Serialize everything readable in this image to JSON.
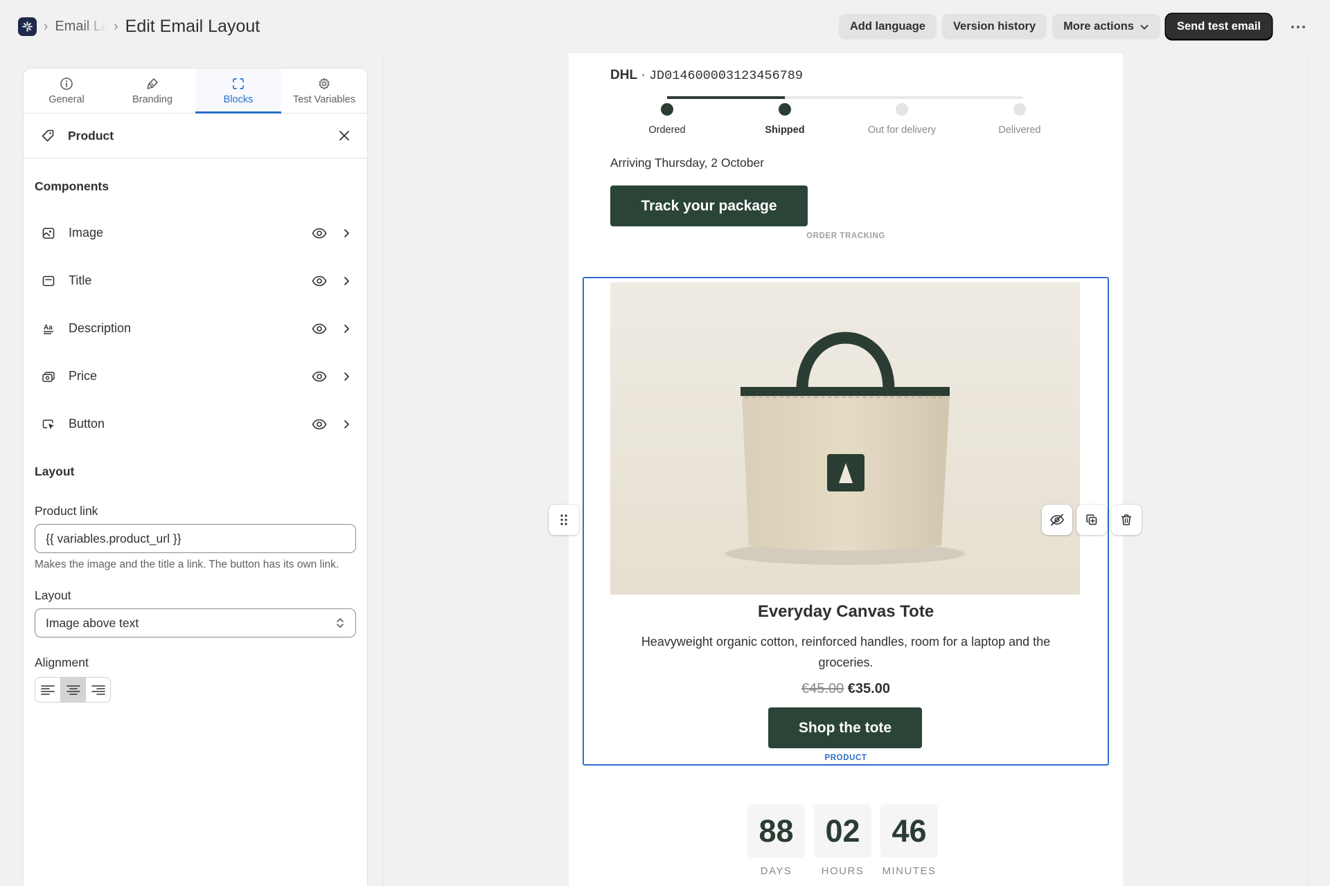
{
  "header": {
    "breadcrumb_parent": "Email Layouts",
    "page_title": "Edit Email Layout",
    "actions": {
      "add_language": "Add language",
      "version_history": "Version history",
      "more_actions": "More actions",
      "send_test_email": "Send test email"
    }
  },
  "panel": {
    "tabs": [
      {
        "label": "General",
        "icon": "info-icon"
      },
      {
        "label": "Branding",
        "icon": "paint-brush-icon"
      },
      {
        "label": "Blocks",
        "icon": "frame-icon",
        "active": true
      },
      {
        "label": "Test Variables",
        "icon": "gear-icon"
      }
    ],
    "block_title": "Product",
    "components_heading": "Components",
    "components": [
      {
        "label": "Image",
        "icon": "image-icon"
      },
      {
        "label": "Title",
        "icon": "title-icon"
      },
      {
        "label": "Description",
        "icon": "text-format-icon"
      },
      {
        "label": "Price",
        "icon": "price-icon"
      },
      {
        "label": "Button",
        "icon": "cursor-click-icon"
      }
    ],
    "layout_heading": "Layout",
    "product_link": {
      "label": "Product link",
      "value": "{{ variables.product_url }}",
      "help": "Makes the image and the title a link. The button has its own link."
    },
    "layout_select": {
      "label": "Layout",
      "value": "Image above text"
    },
    "alignment": {
      "label": "Alignment",
      "selected": "center"
    }
  },
  "preview": {
    "carrier": "DHL",
    "separator": "·",
    "tracking_number": "JD014600003123456789",
    "progress": 0.33,
    "steps": [
      {
        "label": "Ordered",
        "state": "done"
      },
      {
        "label": "Shipped",
        "state": "current"
      },
      {
        "label": "Out for delivery",
        "state": "pending"
      },
      {
        "label": "Delivered",
        "state": "pending"
      }
    ],
    "arriving": "Arriving Thursday, 2 October",
    "track_button": "Track your package",
    "order_tracking_tag": "ORDER TRACKING",
    "product": {
      "title": "Everyday Canvas Tote",
      "description": "Heavyweight organic cotton, reinforced handles, room for a laptop and the groceries.",
      "old_price": "€45.00",
      "new_price": "€35.00",
      "button": "Shop the tote",
      "tag": "PRODUCT"
    },
    "countdown": [
      {
        "value": "88",
        "label": "DAYS"
      },
      {
        "value": "02",
        "label": "HOURS"
      },
      {
        "value": "46",
        "label": "MINUTES"
      }
    ]
  },
  "colors": {
    "accent": "#2c6ecb",
    "brand_dark_green": "#2b4438",
    "primary_button": "#303030"
  }
}
